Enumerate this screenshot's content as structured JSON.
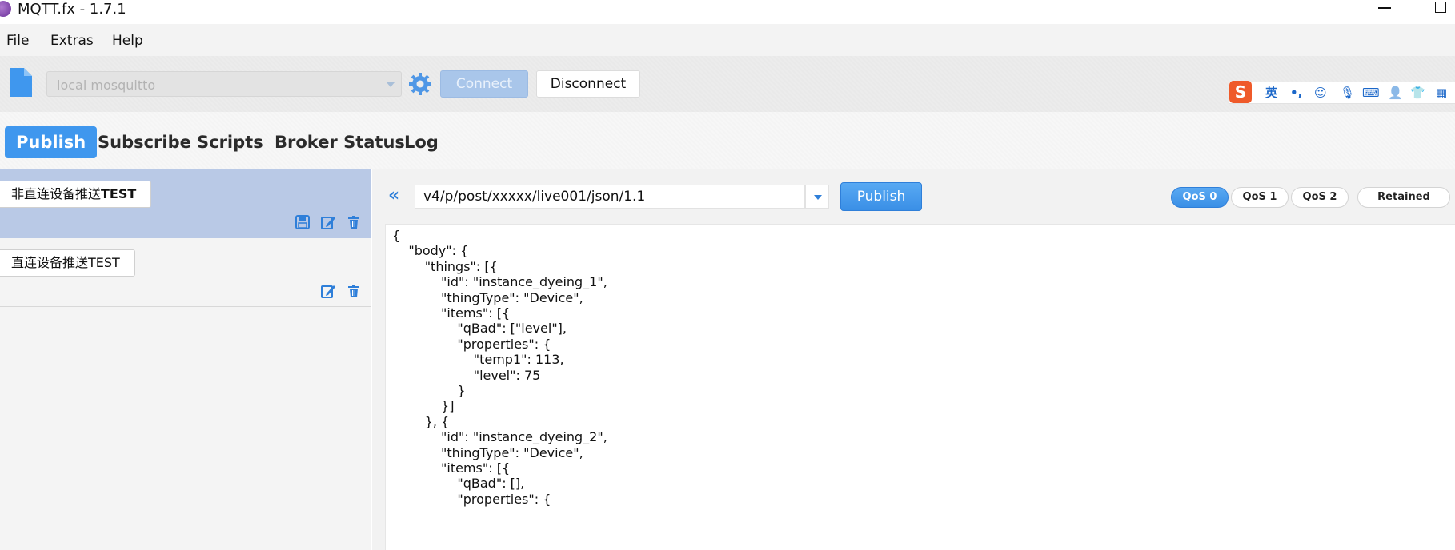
{
  "window": {
    "title": "MQTT.fx - 1.7.1"
  },
  "menu": {
    "items": [
      "File",
      "Extras",
      "Help"
    ]
  },
  "toolbar": {
    "profile_value": "local mosquitto",
    "connect_label": "Connect",
    "disconnect_label": "Disconnect",
    "connect_enabled": false
  },
  "ime": {
    "logo": "S",
    "items": [
      "英",
      "•,",
      "☺",
      "🎙",
      "⌨",
      "👤",
      "👕",
      "▦"
    ]
  },
  "tabs": {
    "items": [
      "Publish",
      "Subscribe",
      "Scripts",
      "Broker Status",
      "Log"
    ],
    "active": "Publish"
  },
  "messages": [
    {
      "label_prefix": "非直连设备推送",
      "label_suffix": "TEST",
      "selected": true
    },
    {
      "label_prefix": "直连设备推送",
      "label_suffix": "TEST",
      "selected": false
    }
  ],
  "publish": {
    "topic": "v4/p/post/xxxxx/live001/json/1.1",
    "publish_label": "Publish",
    "qos": [
      "QoS 0",
      "QoS 1",
      "QoS 2"
    ],
    "qos_selected": "QoS 0",
    "retained_label": "Retained",
    "payload_lines": [
      "{",
      "    \"body\": {",
      "        \"things\": [{",
      "            \"id\": \"instance_dyeing_1\",",
      "            \"thingType\": \"Device\",",
      "            \"items\": [{",
      "                \"qBad\": [\"level\"],",
      "                \"properties\": {",
      "                    \"temp1\": 113,",
      "                    \"level\": 75",
      "                }",
      "            }]",
      "        }, {",
      "            \"id\": \"instance_dyeing_2\",",
      "            \"thingType\": \"Device\",",
      "            \"items\": [{",
      "                \"qBad\": [],",
      "                \"properties\": {"
    ]
  },
  "colors": {
    "accent": "#3f97ee",
    "selected_row": "#b9c9e6",
    "icon_blue": "#2f7fd9"
  }
}
